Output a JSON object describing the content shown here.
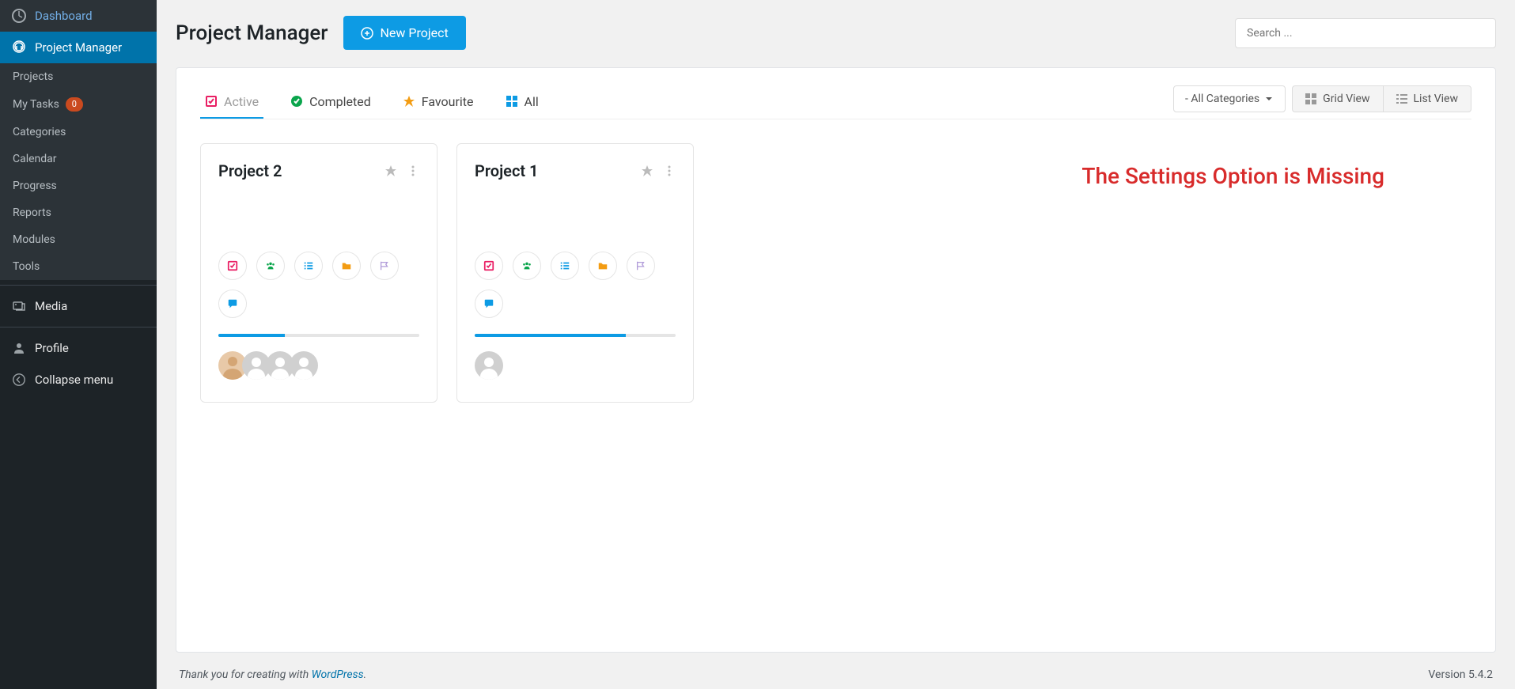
{
  "sidebar": {
    "dashboard": "Dashboard",
    "project_manager": "Project Manager",
    "submenu": {
      "projects": "Projects",
      "my_tasks": "My Tasks",
      "my_tasks_count": "0",
      "categories": "Categories",
      "calendar": "Calendar",
      "progress": "Progress",
      "reports": "Reports",
      "modules": "Modules",
      "tools": "Tools"
    },
    "media": "Media",
    "profile": "Profile",
    "collapse": "Collapse menu"
  },
  "header": {
    "title": "Project Manager",
    "new_button": "New Project",
    "search_placeholder": "Search ..."
  },
  "tabs": {
    "active": "Active",
    "completed": "Completed",
    "favourite": "Favourite",
    "all": "All"
  },
  "filters": {
    "categories": "- All Categories",
    "grid_view": "Grid View",
    "list_view": "List View"
  },
  "projects": [
    {
      "title": "Project 2",
      "progress": 33,
      "avatars": 4,
      "firstAvatarIsHuman": true
    },
    {
      "title": "Project 1",
      "progress": 75,
      "avatars": 1,
      "firstAvatarIsHuman": false
    }
  ],
  "annotation": "The Settings Option is Missing",
  "footer": {
    "prefix": "Thank you for creating with ",
    "link": "WordPress",
    "suffix": ".",
    "version": "Version 5.4.2"
  }
}
